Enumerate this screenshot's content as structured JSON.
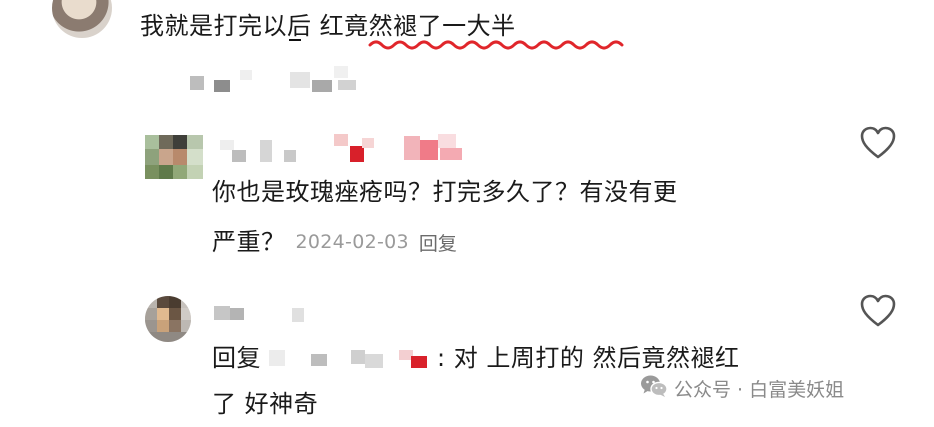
{
  "top_comment": {
    "text_plain": "我就是打完以后 ",
    "text_highlight": "红竟然褪了一大半"
  },
  "comment_1": {
    "body_line1": "你也是玫瑰痤疮吗？打完多久了？有没有更",
    "body_line2": "严重？",
    "date": "2024-02-03",
    "reply_label": "回复"
  },
  "comment_2": {
    "reply_prefix": "回复",
    "body_line1": ": 对 上周打的 然后竟然褪红",
    "body_line2": "了 好神奇"
  },
  "watermark": {
    "text": "公众号 · 白富美妖姐",
    "icon": "wechat-icon"
  },
  "colors": {
    "highlight_underline": "#e0262b",
    "meta": "#9a9a9a"
  }
}
